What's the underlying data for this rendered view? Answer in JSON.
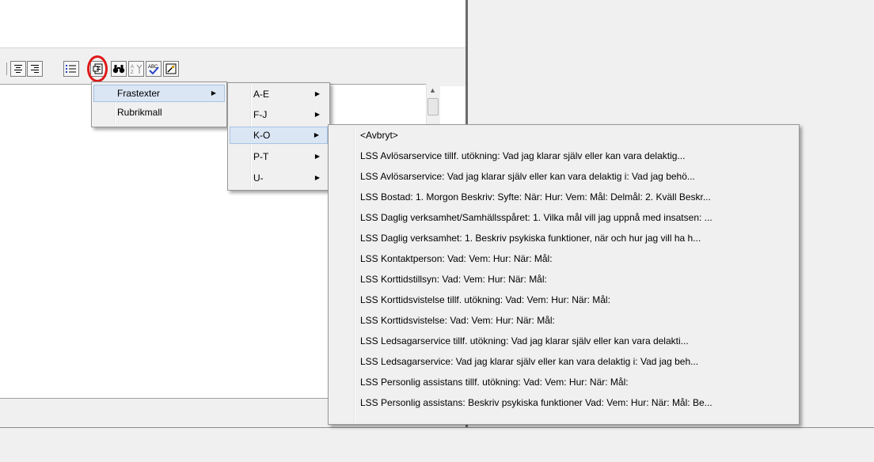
{
  "toolbar": {
    "buttons": [
      {
        "name": "align-center-icon"
      },
      {
        "name": "align-right-icon"
      },
      {
        "name": "bullet-list-icon"
      },
      {
        "name": "insert-text-template-icon"
      },
      {
        "name": "binoculars-find-icon"
      },
      {
        "name": "sort-icon"
      },
      {
        "name": "spell-check-icon"
      },
      {
        "name": "image-tool-icon"
      }
    ],
    "highlight_color": "#e01818"
  },
  "menus": {
    "root": {
      "items": [
        {
          "label": "Frastexter",
          "has_submenu": true,
          "selected": true
        },
        {
          "label": "Rubrikmall",
          "has_submenu": false,
          "selected": false
        }
      ]
    },
    "letters": {
      "items": [
        {
          "label": "A-E",
          "has_submenu": true,
          "selected": false
        },
        {
          "label": "F-J",
          "has_submenu": true,
          "selected": false
        },
        {
          "label": "K-O",
          "has_submenu": true,
          "selected": true
        },
        {
          "label": "P-T",
          "has_submenu": true,
          "selected": false
        },
        {
          "label": "U-",
          "has_submenu": true,
          "selected": false
        }
      ]
    },
    "phrases": {
      "items": [
        "<Avbryt>",
        "LSS Avlösarservice tillf. utökning: Vad jag klarar själv eller kan vara delaktig...",
        "LSS Avlösarservice: Vad jag klarar själv eller kan vara delaktig i: Vad jag behö...",
        "LSS Bostad: 1. Morgon Beskriv: Syfte: När: Hur: Vem: Mål: Delmål: 2. Kväll Beskr...",
        "LSS Daglig verksamhet/Samhällsspåret: 1. Vilka mål vill jag uppnå med insatsen: ...",
        "LSS Daglig verksamhet: 1. Beskriv psykiska funktioner, när och hur jag vill ha h...",
        "LSS Kontaktperson: Vad: Vem: Hur: När: Mål:",
        "LSS Korttidstillsyn: Vad: Vem: Hur: När: Mål:",
        "LSS Korttidsvistelse tillf. utökning: Vad: Vem: Hur: När: Mål:",
        "LSS Korttidsvistelse: Vad: Vem: Hur: När: Mål:",
        "LSS Ledsagarservice tillf. utökning: Vad jag klarar själv eller kan vara delakti...",
        "LSS Ledsagarservice: Vad jag klarar själv eller kan vara delaktig i: Vad jag beh...",
        "LSS Personlig assistans tillf. utökning: Vad: Vem: Hur: När: Mål:",
        "LSS Personlig assistans: Beskriv psykiska funktioner Vad: Vem: Hur: När: Mål: Be..."
      ]
    }
  }
}
